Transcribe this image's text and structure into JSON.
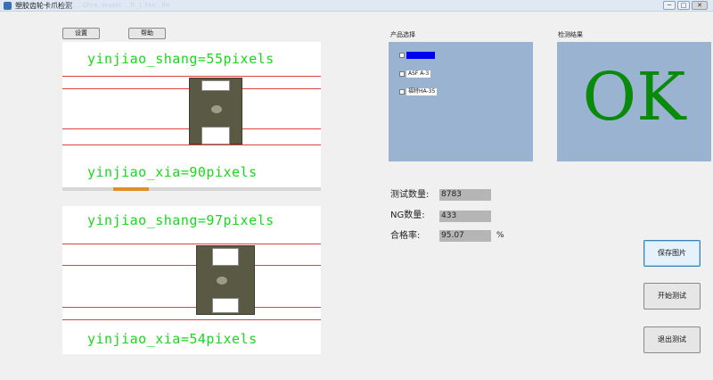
{
  "window": {
    "title": "塑胶齿轮卡爪检测",
    "ghost_title": "Pra..., Ohra, eraser ...Tr._L Fee...ffe",
    "minimize": "─",
    "maximize": "□",
    "close": "✕"
  },
  "toolbar": {
    "settings_label": "设置",
    "help_label": "帮助"
  },
  "image_top": {
    "upper_measure": "yinjiao_shang=55pixels",
    "lower_measure": "yinjiao_xia=90pixels"
  },
  "image_bottom": {
    "upper_measure": "yinjiao_shang=97pixels",
    "lower_measure": "yinjiao_xia=54pixels"
  },
  "product_select": {
    "title": "产品选择",
    "options": [
      {
        "label": "",
        "selected": true
      },
      {
        "label": "ASF A-3",
        "selected": false
      },
      {
        "label": "福特HA-35",
        "selected": false
      }
    ]
  },
  "result": {
    "title": "检测结果",
    "value": "OK",
    "color": "#0a8a0a"
  },
  "stats": {
    "count_label": "测试数量:",
    "count_value": "8783",
    "ng_label": "NG数量:",
    "ng_value": "433",
    "rate_label": "合格率:",
    "rate_value": "95.07",
    "rate_unit": "%"
  },
  "actions": {
    "save_label": "保存图片",
    "start_label": "开始测试",
    "exit_label": "退出测试"
  }
}
